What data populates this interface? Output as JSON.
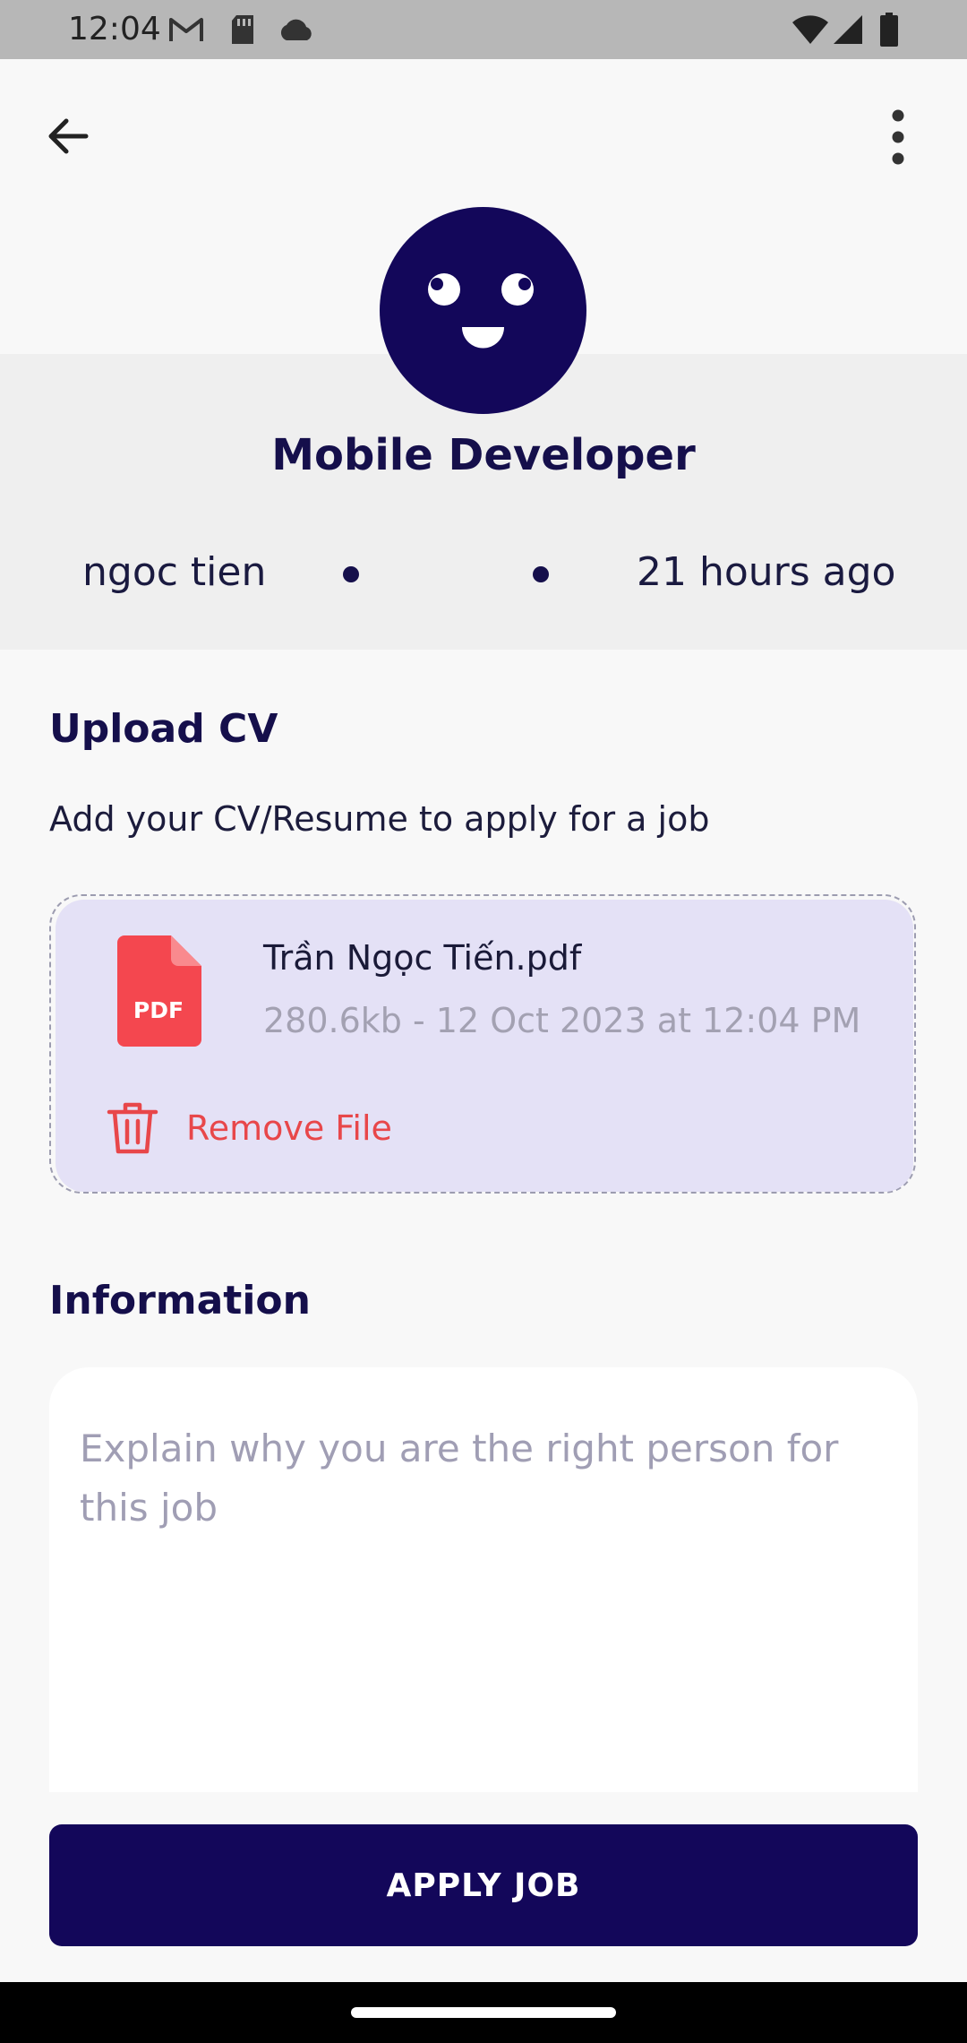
{
  "status_bar": {
    "time": "12:04",
    "left_icons": [
      "gmail-icon",
      "sim-card-icon",
      "cloud-icon"
    ],
    "right_icons": [
      "wifi-icon",
      "signal-icon",
      "battery-icon"
    ]
  },
  "app_bar": {
    "back_icon": "arrow-left-icon",
    "more_icon": "more-vertical-icon"
  },
  "job": {
    "title": "Mobile Developer",
    "poster": "ngoc tien",
    "posted_ago": "21 hours ago"
  },
  "upload_cv": {
    "title": "Upload CV",
    "subtitle": "Add your CV/Resume to apply for a job",
    "file": {
      "name": "Trần Ngọc Tiến.pdf",
      "meta": "280.6kb - 12 Oct 2023 at 12:04 PM",
      "type_label": "PDF"
    },
    "remove_label": "Remove File"
  },
  "information": {
    "title": "Information",
    "placeholder": "Explain why you are the right person for this job"
  },
  "apply_button": {
    "label": "APPLY JOB"
  },
  "colors": {
    "primary": "#13075a",
    "danger": "#e8474a",
    "file_card_bg": "#e4e1f6",
    "pdf_red": "#f4474f"
  }
}
